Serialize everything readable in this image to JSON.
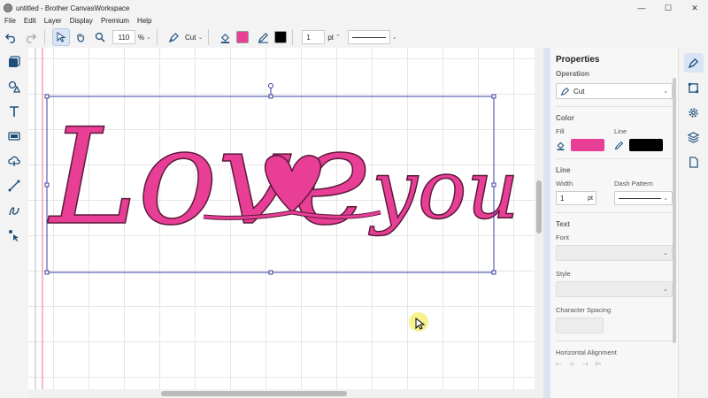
{
  "window": {
    "title": "untitled - Brother CanvasWorkspace"
  },
  "menu": [
    "File",
    "Edit",
    "Layer",
    "Display",
    "Premium",
    "Help"
  ],
  "toolbar": {
    "zoom_value": "110",
    "zoom_unit": "%",
    "operation": "Cut",
    "fill_color": "#e83e96",
    "line_color": "#000000",
    "stroke_width": "1",
    "stroke_unit": "pt"
  },
  "canvas": {
    "text_left": "Love",
    "text_right": "you",
    "fill_color": "#e83e96",
    "outline_color": "#5a1a3a",
    "selection_color": "#3b3fa0"
  },
  "properties": {
    "title": "Properties",
    "operation_label": "Operation",
    "operation_value": "Cut",
    "color_label": "Color",
    "fill_label": "Fill",
    "line_label": "Line",
    "fill_color": "#e83e96",
    "line_color": "#000000",
    "line_section": "Line",
    "width_label": "Width",
    "width_value": "1",
    "width_unit": "pt",
    "dash_label": "Dash Pattern",
    "text_section": "Text",
    "font_label": "Font",
    "style_label": "Style",
    "spacing_label": "Character Spacing",
    "halign_label": "Horizontal Alignment"
  }
}
